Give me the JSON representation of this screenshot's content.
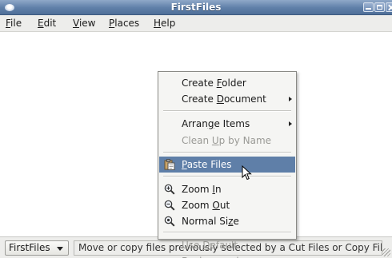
{
  "window": {
    "title": "FirstFiles",
    "menu_icon": "window-menu-icon",
    "controls": [
      "minimize-icon",
      "maximize-icon",
      "close-icon"
    ]
  },
  "menubar": {
    "items": [
      {
        "label": "File",
        "mnemonic": "F",
        "rest": "ile"
      },
      {
        "label": "Edit",
        "mnemonic": "E",
        "rest": "dit"
      },
      {
        "label": "View",
        "mnemonic": "V",
        "rest": "iew"
      },
      {
        "label": "Places",
        "mnemonic": "P",
        "rest": "laces"
      },
      {
        "label": "Help",
        "mnemonic": "H",
        "rest": "elp"
      }
    ]
  },
  "context_menu": {
    "create_folder": {
      "pre": "Create ",
      "mnem": "F",
      "post": "older"
    },
    "create_document": {
      "pre": "Create ",
      "mnem": "D",
      "post": "ocument"
    },
    "arrange_items": {
      "pre": "Arran",
      "mnem": "g",
      "post": "e Items"
    },
    "clean_up": {
      "pre": "Clean ",
      "mnem": "U",
      "post": "p by Name"
    },
    "paste_files": {
      "pre": "",
      "mnem": "P",
      "post": "aste Files"
    },
    "zoom_in": {
      "pre": "Zoom ",
      "mnem": "I",
      "post": "n"
    },
    "zoom_out": {
      "pre": "Zoom ",
      "mnem": "O",
      "post": "ut"
    },
    "normal_size": {
      "pre": "Normal Si",
      "mnem": "z",
      "post": "e"
    },
    "use_default_background": {
      "pre": "Use ",
      "mnem": "D",
      "post": "efault Background"
    }
  },
  "statusbar": {
    "dropdown_label": "FirstFiles",
    "message": "Move or copy files previously selected by a Cut Files or Copy Files"
  },
  "colors": {
    "titlebar": "#5f7fa8",
    "selection": "#5f7fa8",
    "menu_bg": "#f5f5f3"
  }
}
